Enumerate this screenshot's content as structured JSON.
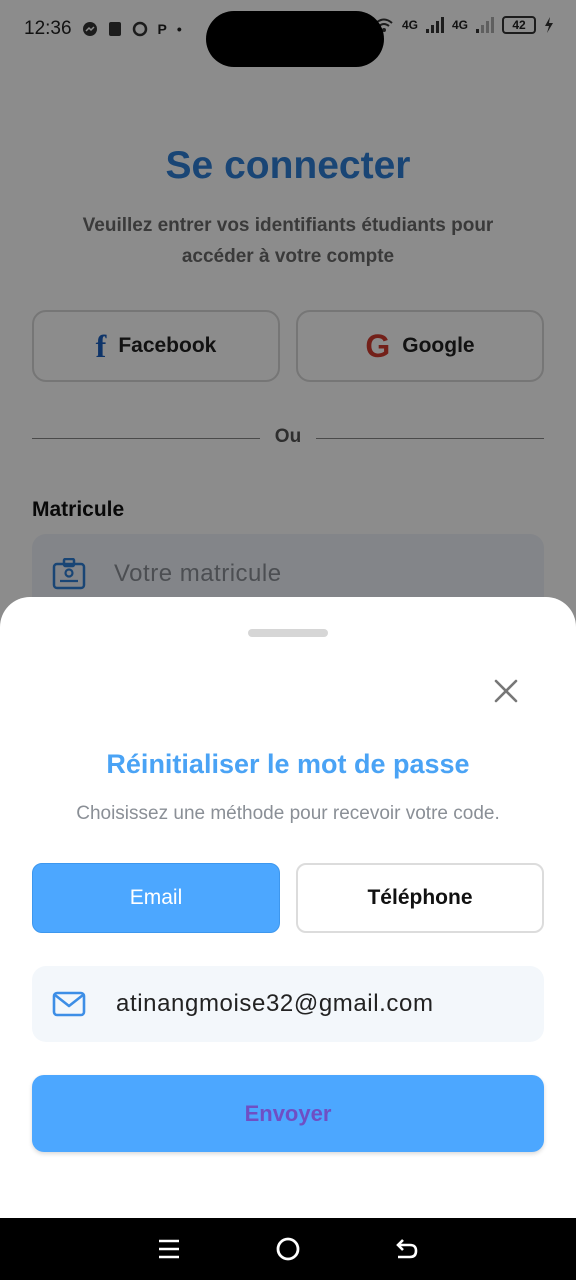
{
  "status_bar": {
    "time": "12:36",
    "network_1": "4G",
    "network_2": "4G",
    "battery": "42"
  },
  "login": {
    "title": "Se connecter",
    "subtitle": "Veuillez entrer vos identifiants étudiants pour accéder à votre compte",
    "facebook_label": "Facebook",
    "google_label": "Google",
    "divider_text": "Ou",
    "matricule_label": "Matricule",
    "matricule_placeholder": "Votre matricule"
  },
  "reset_sheet": {
    "title": "Réinitialiser le mot de passe",
    "subtitle": "Choisissez une méthode pour recevoir votre code.",
    "tabs": [
      {
        "label": "Email",
        "selected": true
      },
      {
        "label": "Téléphone",
        "selected": false
      }
    ],
    "email_value": "atinangmoise32@gmail.com",
    "send_label": "Envoyer"
  },
  "colors": {
    "accent": "#4ca7ff",
    "title_blue": "#2f7fd6",
    "send_text": "#6f4fc4"
  },
  "icons": {
    "close": "close-icon",
    "email": "email-icon",
    "id_card": "id-card-icon",
    "facebook": "facebook-icon",
    "google": "google-icon"
  }
}
